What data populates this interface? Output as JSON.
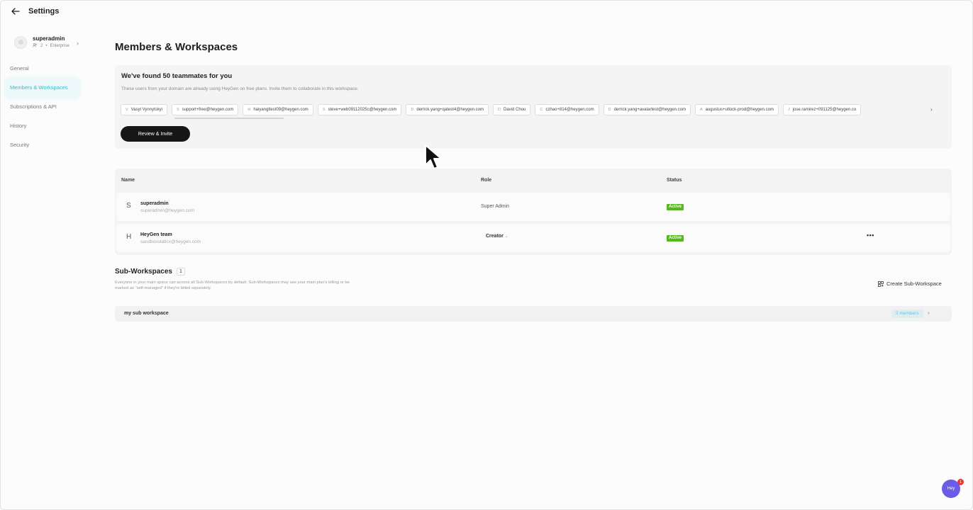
{
  "topbar": {
    "title": "Settings"
  },
  "account": {
    "name": "superadmin",
    "members": "2",
    "plan": "Enterprise"
  },
  "nav": {
    "items": [
      {
        "label": "General",
        "active": false
      },
      {
        "label": "Members & Workspaces",
        "active": true
      },
      {
        "label": "Subscriptions & API",
        "active": false
      },
      {
        "label": "History",
        "active": false
      },
      {
        "label": "Security",
        "active": false
      }
    ]
  },
  "page": {
    "title": "Members & Workspaces"
  },
  "invite": {
    "heading": "We've found 50 teammates for you",
    "description": "These users from your domain are already using HeyGen on free plans. Invite them to collaborate in this workspace.",
    "chips": [
      {
        "initial": "V",
        "label": "Vasyl Vynnytskyi"
      },
      {
        "initial": "S",
        "label": "support+free@heygen.com"
      },
      {
        "initial": "H",
        "label": "haiyangltest09@heygen.com"
      },
      {
        "initial": "S",
        "label": "steve+web09112025c@heygen.com"
      },
      {
        "initial": "D",
        "label": "derrick.yang+qatest4@heygen.com"
      },
      {
        "initial": "D",
        "label": "David Chou"
      },
      {
        "initial": "C",
        "label": "czhao+814@heygen.com"
      },
      {
        "initial": "D",
        "label": "derrick.yang+avatartest@heygen.com"
      },
      {
        "initial": "A",
        "label": "augustus+utlock-prod@heygen.com"
      },
      {
        "initial": "J",
        "label": "jose.ramirez+091125@heygen.co"
      }
    ],
    "button_label": "Review & Invite"
  },
  "members": {
    "headers": {
      "name": "Name",
      "role": "Role",
      "status": "Status"
    },
    "rows": [
      {
        "initial": "S",
        "name": "superadmin",
        "email": "superadmin@heygen.com",
        "role": "Super Admin",
        "status": "Active"
      },
      {
        "initial": "H",
        "name": "HeyGen team",
        "email": "sandboxstaticx@heygen.com",
        "role": "Creator",
        "status": "Active"
      }
    ]
  },
  "sub_workspaces": {
    "title": "Sub-Workspaces",
    "count": "1",
    "description": "Everyone in your main space can access all Sub-Workspaces by default. Sub-Workspaces may use your main plan's billing or be marked as \"self-managed\" if they're billed separately.",
    "create_label": "Create Sub-Workspace",
    "items": [
      {
        "name": "my sub workspace",
        "members": "2 members"
      }
    ]
  },
  "help": {
    "label": "Hey",
    "badge": "1"
  },
  "colors": {
    "accent": "#3bb8cf",
    "active_badge": "#56b81e",
    "help": "#6b5ce7"
  }
}
